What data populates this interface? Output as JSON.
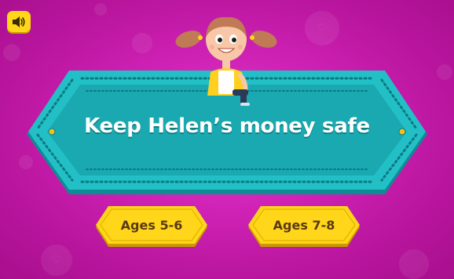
{
  "game": {
    "title": "Keep Helen’s money safe",
    "character_name": "Helen"
  },
  "controls": {
    "sound_icon": "speaker-icon"
  },
  "age_options": [
    {
      "label": "Ages 5-6"
    },
    {
      "label": "Ages 7-8"
    }
  ],
  "colors": {
    "background": "#c01aa3",
    "banner": "#1fb8be",
    "banner_dark": "#0f8f96",
    "button_yellow": "#ffd61a",
    "button_text": "#5a3a14"
  }
}
